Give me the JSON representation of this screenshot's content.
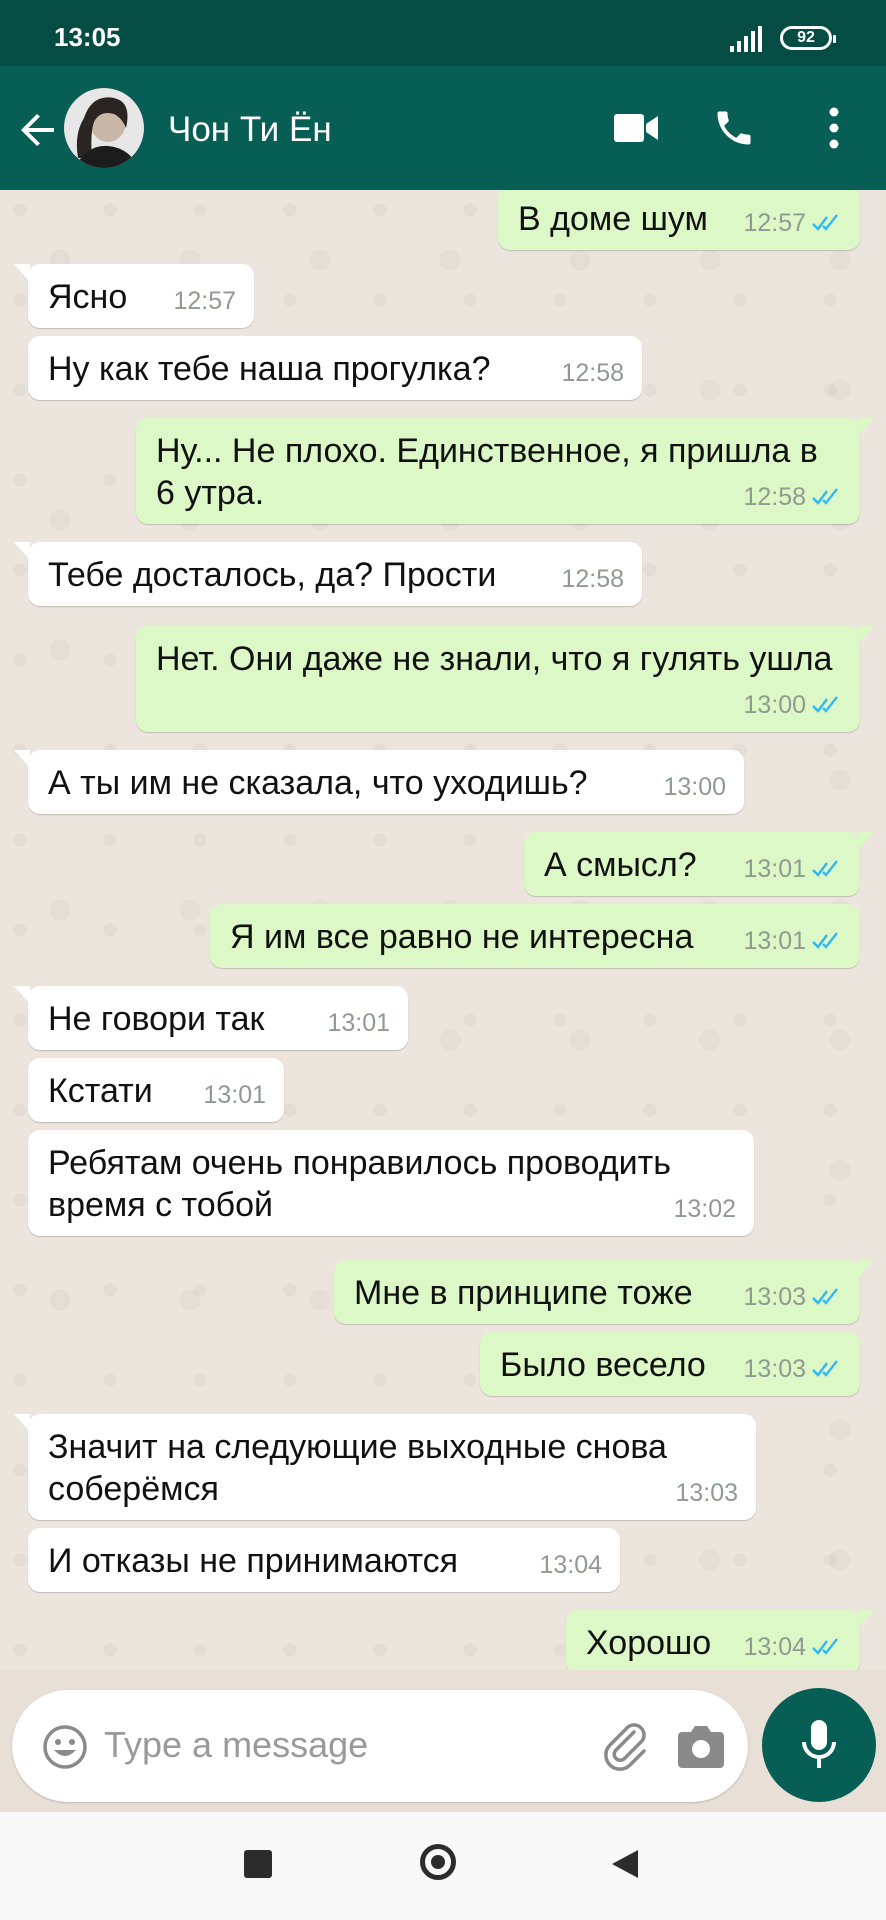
{
  "status_bar": {
    "time": "13:05",
    "battery": "92"
  },
  "header": {
    "contact_name": "Чон Ти Ён"
  },
  "messages": [
    {
      "dir": "out",
      "text": "В доме шум",
      "time": "12:57",
      "read": true
    },
    {
      "dir": "in",
      "text": "Ясно",
      "time": "12:57"
    },
    {
      "dir": "in",
      "text": "Ну как тебе наша прогулка?",
      "time": "12:58"
    },
    {
      "dir": "out",
      "text": "Ну... Не плохо. Единственное, я пришла в 6 утра.",
      "time": "12:58",
      "read": true
    },
    {
      "dir": "in",
      "text": "Тебе досталось, да? Прости",
      "time": "12:58"
    },
    {
      "dir": "out",
      "text": "Нет. Они даже не знали, что я гулять ушла",
      "time": "13:00",
      "read": true
    },
    {
      "dir": "in",
      "text": "А ты им не сказала, что уходишь?",
      "time": "13:00"
    },
    {
      "dir": "out",
      "text": "А смысл?",
      "time": "13:01",
      "read": true
    },
    {
      "dir": "out",
      "text": "Я им все равно не интересна",
      "time": "13:01",
      "read": true
    },
    {
      "dir": "in",
      "text": "Не говори так",
      "time": "13:01"
    },
    {
      "dir": "in",
      "text": "Кстати",
      "time": "13:01"
    },
    {
      "dir": "in",
      "text": "Ребятам очень понравилось проводить время с тобой",
      "time": "13:02"
    },
    {
      "dir": "out",
      "text": "Мне в принципе тоже",
      "time": "13:03",
      "read": true
    },
    {
      "dir": "out",
      "text": "Было весело",
      "time": "13:03",
      "read": true
    },
    {
      "dir": "in",
      "text": "Значит на следующие выходные снова соберёмся",
      "time": "13:03"
    },
    {
      "dir": "in",
      "text": "И отказы не принимаются",
      "time": "13:04"
    },
    {
      "dir": "out",
      "text": "Хорошо",
      "time": "13:04",
      "read": true
    }
  ],
  "composer": {
    "placeholder": "Type a message"
  },
  "colors": {
    "header": "#075e54",
    "status_bar": "#054d44",
    "outgoing_bubble": "#dcf8c6",
    "incoming_bubble": "#ffffff",
    "read_ticks": "#34b7f1"
  }
}
